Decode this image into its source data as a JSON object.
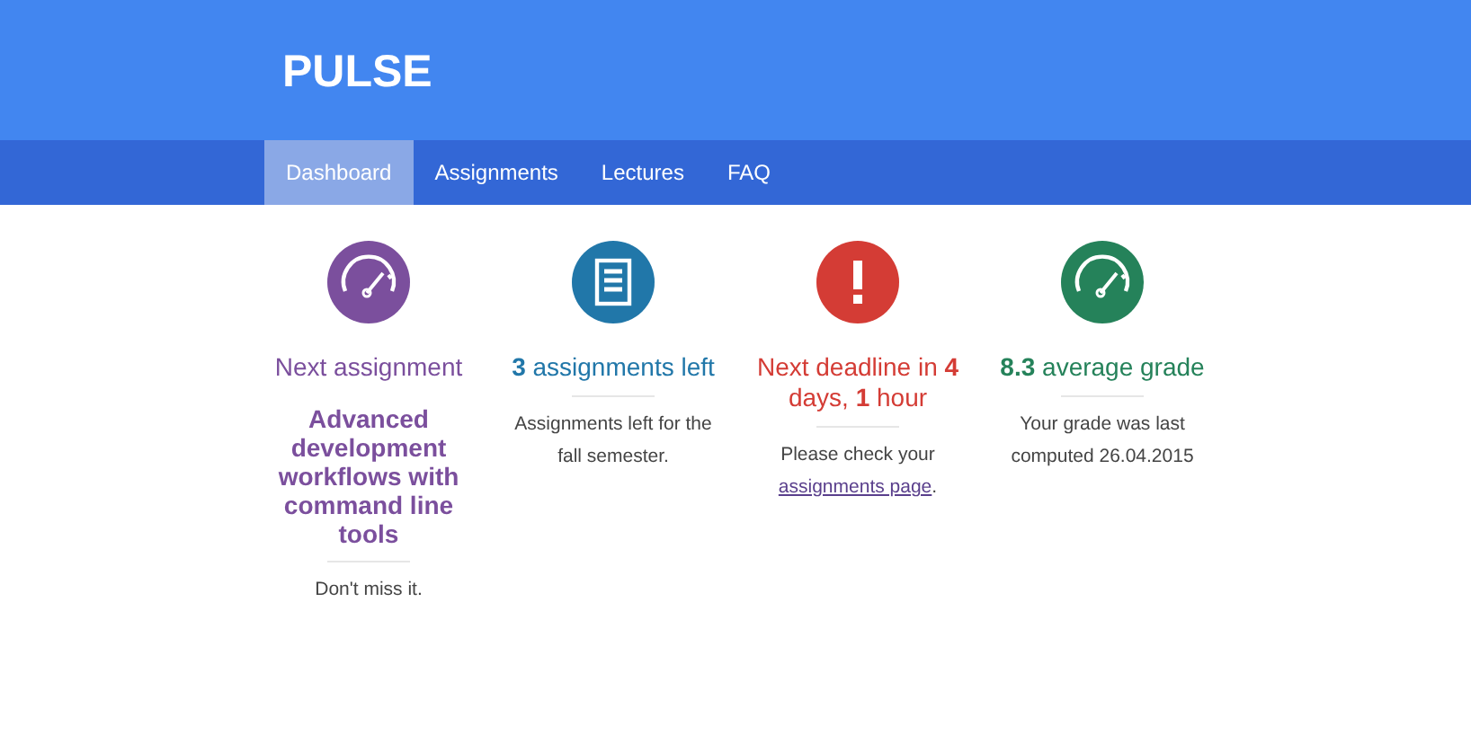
{
  "header": {
    "logo": "PULSE"
  },
  "nav": [
    {
      "label": "Dashboard",
      "selected": true
    },
    {
      "label": "Assignments",
      "selected": false
    },
    {
      "label": "Lectures",
      "selected": false
    },
    {
      "label": "FAQ",
      "selected": false
    }
  ],
  "cards": [
    {
      "kind": "gauge",
      "color": "#7b4f9d",
      "headline": "Next assignment",
      "highlight": "Advanced development workflows with command line tools",
      "body": [
        {
          "kind": "text",
          "text": "Don't miss it."
        }
      ]
    },
    {
      "kind": "document",
      "color": "#2177a9",
      "headline": "**3** assignments left",
      "body": [
        {
          "kind": "text",
          "text": "Assignments left for the fall semester."
        }
      ]
    },
    {
      "kind": "alert",
      "color": "#d43c35",
      "headline": "Next deadline in **4** days, **1** hour",
      "body": [
        {
          "kind": "text",
          "text": "Please check your "
        },
        {
          "kind": "link",
          "text": "assignments page"
        },
        {
          "kind": "text",
          "text": "."
        }
      ]
    },
    {
      "kind": "gauge",
      "color": "#25825a",
      "headline": "**8.3** average grade",
      "body": [
        {
          "kind": "text",
          "text": "Your grade was last computed 26.04.2015"
        }
      ]
    }
  ]
}
